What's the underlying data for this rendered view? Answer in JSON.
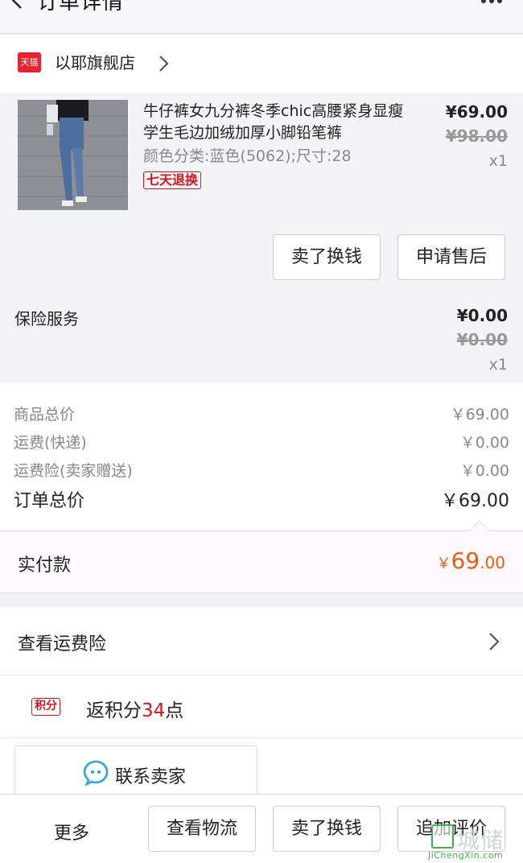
{
  "header": {
    "title": "订单详情"
  },
  "shop": {
    "badge": "天猫",
    "name": "以耶旗舰店"
  },
  "item": {
    "title": "牛仔裤女九分裤冬季chic高腰紧身显瘦学生毛边加绒加厚小脚铅笔裤",
    "sku": "颜色分类:蓝色(5062);尺寸:28",
    "tag": "七天退换",
    "price": "¥69.00",
    "original_price": "¥98.00",
    "quantity": "x1",
    "buttons": {
      "sell": "卖了换钱",
      "after_sale": "申请售后"
    }
  },
  "insurance": {
    "label": "保险服务",
    "price": "¥0.00",
    "original_price": "¥0.00",
    "quantity": "x1"
  },
  "summary": {
    "rows": [
      {
        "label": "商品总价",
        "value": "￥69.00"
      },
      {
        "label": "运费(快递)",
        "value": "￥0.00"
      },
      {
        "label": "运费险(卖家赠送)",
        "value": "￥0.00"
      }
    ],
    "total": {
      "label": "订单总价",
      "value": "￥69.00"
    }
  },
  "paid": {
    "label": "实付款",
    "symbol": "￥",
    "integer": "69",
    "decimal": ".00",
    "accent_color": "#ec5b13"
  },
  "shipping_insurance_link": "查看运费险",
  "points": {
    "badge": "积分",
    "prefix": "返积分",
    "number": "34",
    "suffix": "点"
  },
  "contact": {
    "label": "联系卖家",
    "icon": "chat-bubble-icon"
  },
  "bottom": {
    "more": "更多",
    "logistics": "查看物流",
    "sell": "卖了换钱",
    "review": "追加评价"
  },
  "watermark": {
    "cn": "城储",
    "en": "JiChengXin.com"
  }
}
